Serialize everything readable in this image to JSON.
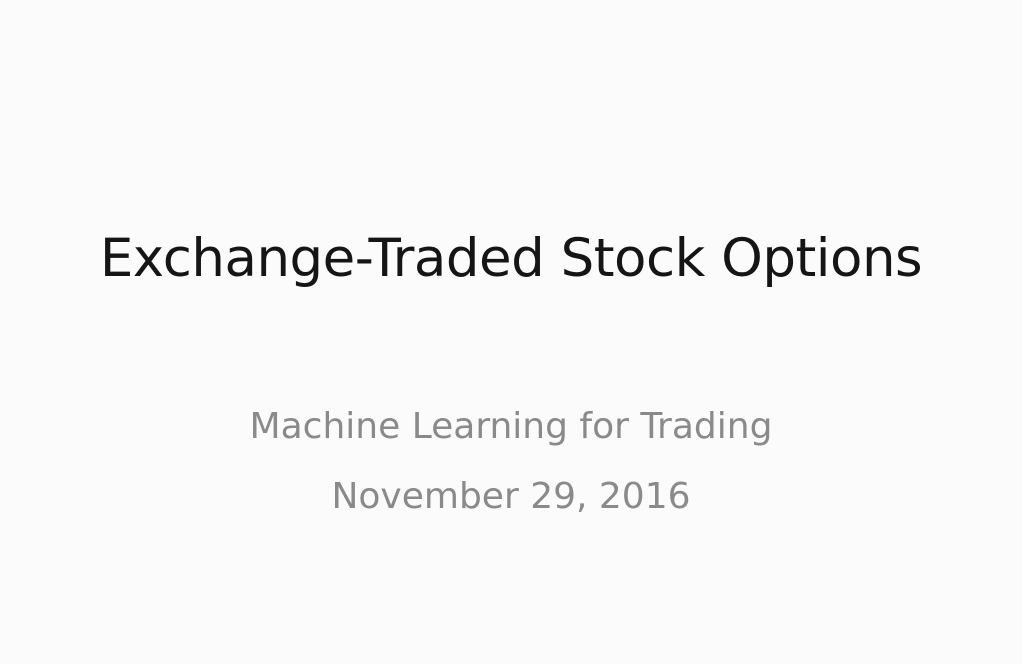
{
  "slide": {
    "title": "Exchange-Traded Stock Options",
    "subtitle_line1": "Machine Learning for Trading",
    "subtitle_line2": "November 29, 2016"
  },
  "colors": {
    "background": "#fbfbfb",
    "title_text": "#151515",
    "subtitle_text": "#8a8a8a"
  }
}
